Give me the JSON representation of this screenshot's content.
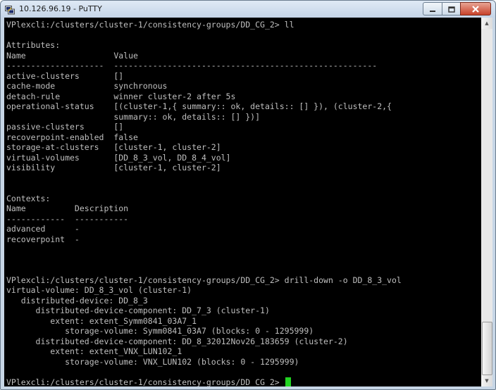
{
  "window": {
    "title": "10.126.96.19 - PuTTY",
    "icon": "putty-icon",
    "controls": [
      "minimize-icon",
      "maximize-icon",
      "close-icon"
    ]
  },
  "colors": {
    "terminal_bg": "#000000",
    "terminal_fg": "#bfbfbf",
    "cursor": "#22d322"
  },
  "terminal": {
    "lines": [
      "VPlexcli:/clusters/cluster-1/consistency-groups/DD_CG_2> ll",
      "",
      "Attributes:",
      "Name                  Value",
      "--------------------  ------------------------------------------------------",
      "active-clusters       []",
      "cache-mode            synchronous",
      "detach-rule           winner cluster-2 after 5s",
      "operational-status    [(cluster-1,{ summary:: ok, details:: [] }), (cluster-2,{",
      "                      summary:: ok, details:: [] })]",
      "passive-clusters      []",
      "recoverpoint-enabled  false",
      "storage-at-clusters   [cluster-1, cluster-2]",
      "virtual-volumes       [DD_8_3_vol, DD_8_4_vol]",
      "visibility            [cluster-1, cluster-2]",
      "",
      "",
      "Contexts:",
      "Name          Description",
      "------------  -----------",
      "advanced      -",
      "recoverpoint  -",
      "",
      "",
      "",
      "VPlexcli:/clusters/cluster-1/consistency-groups/DD_CG_2> drill-down -o DD_8_3_vol",
      "virtual-volume: DD_8_3_vol (cluster-1)",
      "   distributed-device: DD_8_3",
      "      distributed-device-component: DD_7_3 (cluster-1)",
      "         extent: extent_Symm0841_03A7_1",
      "            storage-volume: Symm0841_03A7 (blocks: 0 - 1295999)",
      "      distributed-device-component: DD_8_32012Nov26_183659 (cluster-2)",
      "         extent: extent_VNX_LUN102_1",
      "            storage-volume: VNX_LUN102 (blocks: 0 - 1295999)",
      "",
      "VPlexcli:/clusters/cluster-1/consistency-groups/DD_CG_2> "
    ]
  }
}
